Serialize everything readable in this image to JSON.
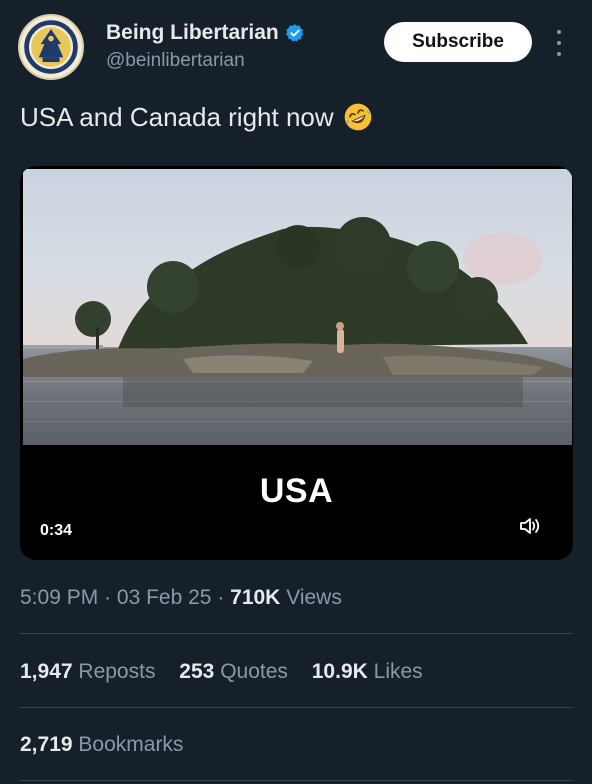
{
  "author": {
    "display_name": "Being Libertarian",
    "handle": "@beinlibertarian",
    "verified": true,
    "avatar_icon": "being-libertarian-seal"
  },
  "subscribe_label": "Subscribe",
  "tweet": {
    "text": "USA and Canada right now",
    "emoji": "rolling-on-floor-laughing"
  },
  "media": {
    "caption": "USA",
    "duration": "0:34",
    "volume_icon": "volume-icon"
  },
  "meta": {
    "time": "5:09 PM",
    "date": "03 Feb 25",
    "views_count": "710K",
    "views_label": "Views"
  },
  "stats": {
    "reposts_count": "1,947",
    "reposts_label": "Reposts",
    "quotes_count": "253",
    "quotes_label": "Quotes",
    "likes_count": "10.9K",
    "likes_label": "Likes",
    "bookmarks_count": "2,719",
    "bookmarks_label": "Bookmarks"
  },
  "colors": {
    "background": "#15202b",
    "primary_text": "#e7e9ea",
    "secondary_text": "#8b98a5",
    "verified_blue": "#1d9bf0",
    "divider": "#38444d"
  }
}
